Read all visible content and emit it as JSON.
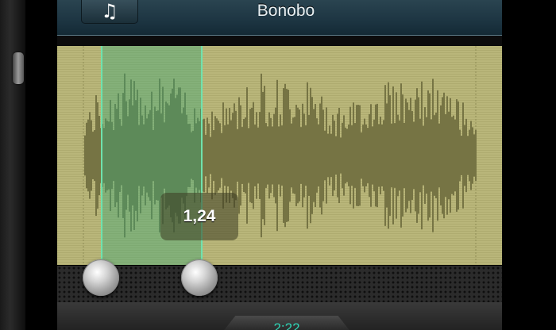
{
  "header": {
    "music_button_icon": "music-note-icon",
    "music_glyph": "♫",
    "title": "Bonobo"
  },
  "selection": {
    "tooltip_value": "1,24"
  },
  "footer": {
    "time_display": "2:22"
  },
  "colors": {
    "header": "#1d3542",
    "waveform_background": "#b9b67a",
    "waveform": "#767444",
    "selection": "#3caa78",
    "selection_border": "#6fe2ad",
    "time_text": "#2fd4b5"
  }
}
